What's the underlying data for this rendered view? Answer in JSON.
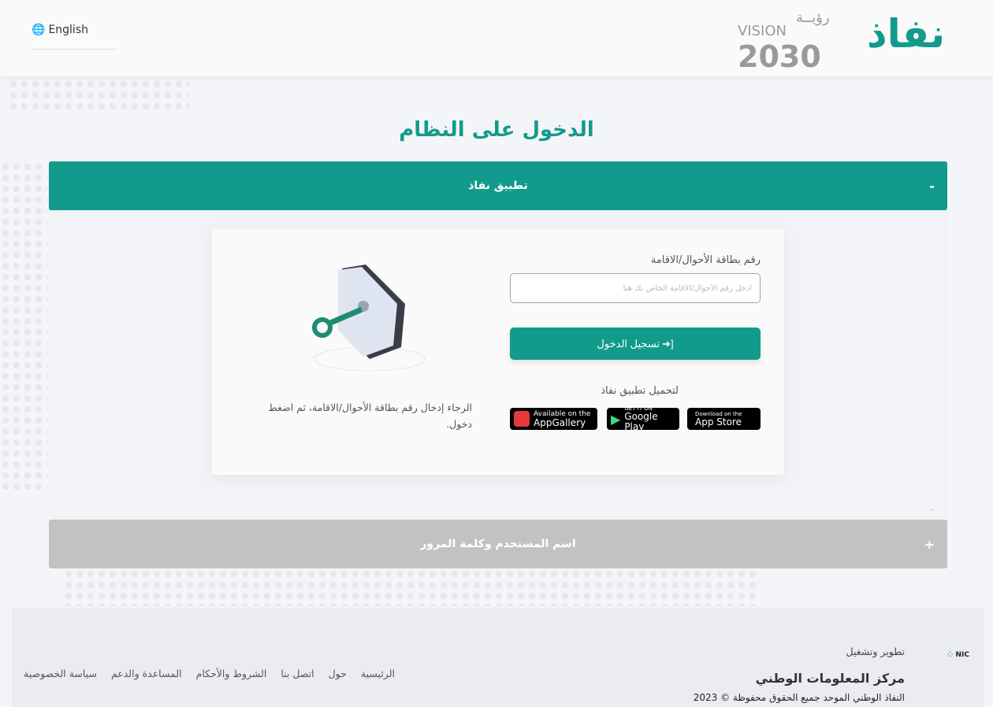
{
  "header": {
    "language_label": "English",
    "vision_text": "VISION 2030",
    "vision_arabic": "رؤيــة",
    "brand_logo": "نفاذ"
  },
  "page_title": "الدخول على النظام",
  "accordion": [
    {
      "title": "تطبيق نفاذ",
      "state_icon": "-"
    },
    {
      "title": "اسم المستخدم وكلمة المرور",
      "state_icon": "+"
    }
  ],
  "panel_collapse_icon": "-",
  "form": {
    "id_label": "رقم بطاقة الأحوال/الاقامة",
    "id_placeholder": "أدخل رقم الأحوال/الاقامة الخاص بك هنا",
    "id_value": "",
    "login_button": "تسجيل الدخول",
    "download_label": "لتحميل تطبيق نفاذ",
    "stores": [
      {
        "small": "Download on the",
        "big": "App Store",
        "icon": "apple-icon"
      },
      {
        "small": "GET IT ON",
        "big": "Google Play",
        "icon": "google-play-icon"
      },
      {
        "small": "Available on the",
        "big": "AppGallery",
        "icon": "huawei-icon"
      }
    ]
  },
  "hint": "الرجاء إدخال رقم بطاقة الأحوال/الاقامة، ثم اضغط دخول.",
  "footer": {
    "developed_by": "تطوير وتشغيل",
    "org": "مركز المعلومات الوطني",
    "nic_logo": "NIC",
    "copyright": "النفاذ الوطني الموحد جميع الحقوق محفوظة © 2023",
    "links": [
      "الرئيسية",
      "حول",
      "اتصل بنا",
      "الشروط والأحكام",
      "المساعدة والدعم",
      "سياسة الخصوصية"
    ]
  },
  "colors": {
    "primary": "#129b8c",
    "inactive": "#c2c2c2"
  }
}
